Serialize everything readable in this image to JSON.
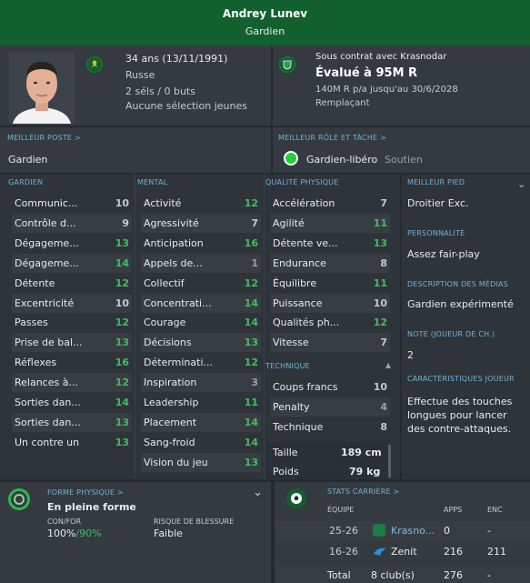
{
  "header": {
    "name": "Andrey Lunev",
    "role": "Gardien"
  },
  "profile": {
    "age": "34 ans (13/11/1991)",
    "nation": "Russe",
    "caps": "2 séls / 0 buts",
    "youth": "Aucune sélection jeunes"
  },
  "contract": {
    "status": "Sous contrat avec Krasnodar",
    "value": "Évalué à 95M R",
    "wage": "140M R p/a jusqu'au 30/6/2028",
    "squad_role": "Remplaçant"
  },
  "best_position": {
    "title": "MEILLEUR POSTE",
    "arrow": ">",
    "value": "Gardien"
  },
  "best_role": {
    "title": "MEILLEUR RÔLE ET TÂCHE",
    "arrow": ">",
    "role": "Gardien-libéro",
    "duty": "Soutien",
    "color": "#21d03a"
  },
  "goalkeeping": {
    "title": "GARDIEN",
    "items": [
      {
        "name": "Communic...",
        "value": "10"
      },
      {
        "name": "Contrôle d...",
        "value": "9"
      },
      {
        "name": "Dégageme...",
        "value": "13"
      },
      {
        "name": "Dégageme...",
        "value": "14"
      },
      {
        "name": "Détente",
        "value": "12"
      },
      {
        "name": "Excentricité",
        "value": "10"
      },
      {
        "name": "Passes",
        "value": "12"
      },
      {
        "name": "Prise de bal...",
        "value": "13"
      },
      {
        "name": "Réflexes",
        "value": "16"
      },
      {
        "name": "Relances à...",
        "value": "12"
      },
      {
        "name": "Sorties dan...",
        "value": "14"
      },
      {
        "name": "Sorties dan...",
        "value": "13"
      },
      {
        "name": "Un contre un",
        "value": "13"
      }
    ]
  },
  "mental": {
    "title": "MENTAL",
    "items": [
      {
        "name": "Activité",
        "value": "12"
      },
      {
        "name": "Agressivité",
        "value": "7"
      },
      {
        "name": "Anticipation",
        "value": "16"
      },
      {
        "name": "Appels de...",
        "value": "1"
      },
      {
        "name": "Collectif",
        "value": "12"
      },
      {
        "name": "Concentrati...",
        "value": "14"
      },
      {
        "name": "Courage",
        "value": "14"
      },
      {
        "name": "Décisions",
        "value": "13"
      },
      {
        "name": "Déterminati...",
        "value": "12"
      },
      {
        "name": "Inspiration",
        "value": "3"
      },
      {
        "name": "Leadership",
        "value": "11"
      },
      {
        "name": "Placement",
        "value": "14"
      },
      {
        "name": "Sang-froid",
        "value": "14"
      },
      {
        "name": "Vision du jeu",
        "value": "13"
      }
    ]
  },
  "physical": {
    "title": "QUALITÉ PHYSIQUE",
    "items": [
      {
        "name": "Accélération",
        "value": "7"
      },
      {
        "name": "Agilité",
        "value": "11"
      },
      {
        "name": "Détente ve...",
        "value": "13"
      },
      {
        "name": "Endurance",
        "value": "8"
      },
      {
        "name": "Équilibre",
        "value": "11"
      },
      {
        "name": "Puissance",
        "value": "10"
      },
      {
        "name": "Qualités ph...",
        "value": "12"
      },
      {
        "name": "Vitesse",
        "value": "7"
      }
    ]
  },
  "technical": {
    "title": "TECHNIQUE",
    "items": [
      {
        "name": "Coups francs",
        "value": "10"
      },
      {
        "name": "Penalty",
        "value": "4"
      },
      {
        "name": "Technique",
        "value": "8"
      }
    ]
  },
  "body": {
    "height_label": "Taille",
    "height": "189 cm",
    "weight_label": "Poids",
    "weight": "79 kg"
  },
  "right": {
    "foot_title": "MEILLEUR PIED",
    "foot": "Droitier Exc.",
    "pers_title": "PERSONNALITÉ",
    "pers": "Assez fair-play",
    "media_title": "DESCRIPTION DES MÉDIAS",
    "media": "Gardien expérimenté",
    "note_title": "NOTE (JOUEUR DE CH.)",
    "note": "2",
    "traits_title": "CARACTÉRISTIQUES JOUEUR",
    "traits": "Effectue des touches longues pour lancer des contre-attaques."
  },
  "fitness": {
    "title": "FORME PHYSIQUE",
    "arrow": ">",
    "state": "En pleine forme",
    "cond_label": "CON/FOR",
    "cond_value": "100%",
    "sharp_value": "/90%",
    "risk_label": "RISQUE DE BLESSURE",
    "risk_value": "Faible"
  },
  "career": {
    "title": "STATS CARRIÈRE",
    "arrow": ">",
    "cols": [
      "ÉQUIPE",
      "APPS",
      "ENC"
    ],
    "rows": [
      {
        "season": "25-26",
        "club": "Krasno...",
        "apps": "0",
        "conc": "-"
      },
      {
        "season": "16-26",
        "club": "Zenit",
        "apps": "216",
        "conc": "211"
      }
    ],
    "total": {
      "label": "Total",
      "clubs": "8 club(s)",
      "apps": "276",
      "conc": "-"
    }
  }
}
